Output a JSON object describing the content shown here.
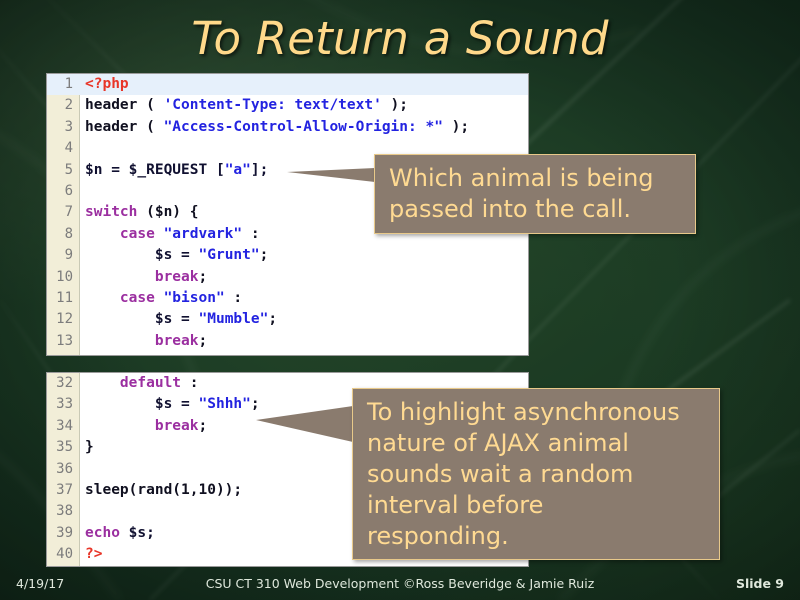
{
  "slide": {
    "title": "To Return a Sound",
    "colors": {
      "background_green": "#163220",
      "title_gold": "#ffd98a",
      "callout_fill": "#8a7b6e",
      "callout_border": "#e8c98a",
      "callout_text": "#ffda92",
      "code_background": "#ffffff",
      "gutter": "#f2eed8",
      "highlight_row": "#e6f0fb",
      "token_tag_red": "#e83528",
      "token_keyword_purple": "#9b2fa0",
      "token_string_blue": "#2323e0"
    }
  },
  "code_top": {
    "lines": [
      {
        "n": "1",
        "highlight": true,
        "tokens": [
          {
            "t": "<?php",
            "c": "tag"
          }
        ]
      },
      {
        "n": "2",
        "highlight": false,
        "tokens": [
          {
            "t": "header ( ",
            "c": "plain"
          },
          {
            "t": "'Content-Type: text/text'",
            "c": "str"
          },
          {
            "t": " );",
            "c": "plain"
          }
        ]
      },
      {
        "n": "3",
        "highlight": false,
        "tokens": [
          {
            "t": "header ( ",
            "c": "plain"
          },
          {
            "t": "\"Access-Control-Allow-Origin: *\"",
            "c": "str"
          },
          {
            "t": " );",
            "c": "plain"
          }
        ]
      },
      {
        "n": "4",
        "highlight": false,
        "tokens": [
          {
            "t": "",
            "c": "plain"
          }
        ]
      },
      {
        "n": "5",
        "highlight": false,
        "tokens": [
          {
            "t": "$n = $_REQUEST [",
            "c": "var"
          },
          {
            "t": "\"a\"",
            "c": "str"
          },
          {
            "t": "];",
            "c": "var"
          }
        ]
      },
      {
        "n": "6",
        "highlight": false,
        "tokens": [
          {
            "t": "",
            "c": "plain"
          }
        ]
      },
      {
        "n": "7",
        "highlight": false,
        "tokens": [
          {
            "t": "switch",
            "c": "kw"
          },
          {
            "t": " ($n) {",
            "c": "plain"
          }
        ]
      },
      {
        "n": "8",
        "highlight": false,
        "tokens": [
          {
            "t": "    ",
            "c": "plain"
          },
          {
            "t": "case",
            "c": "kw"
          },
          {
            "t": " ",
            "c": "plain"
          },
          {
            "t": "\"ardvark\"",
            "c": "str"
          },
          {
            "t": " :",
            "c": "plain"
          }
        ]
      },
      {
        "n": "9",
        "highlight": false,
        "tokens": [
          {
            "t": "        $s = ",
            "c": "var"
          },
          {
            "t": "\"Grunt\"",
            "c": "str"
          },
          {
            "t": ";",
            "c": "plain"
          }
        ]
      },
      {
        "n": "10",
        "highlight": false,
        "tokens": [
          {
            "t": "        ",
            "c": "plain"
          },
          {
            "t": "break",
            "c": "kw"
          },
          {
            "t": ";",
            "c": "plain"
          }
        ]
      },
      {
        "n": "11",
        "highlight": false,
        "tokens": [
          {
            "t": "    ",
            "c": "plain"
          },
          {
            "t": "case",
            "c": "kw"
          },
          {
            "t": " ",
            "c": "plain"
          },
          {
            "t": "\"bison\"",
            "c": "str"
          },
          {
            "t": " :",
            "c": "plain"
          }
        ]
      },
      {
        "n": "12",
        "highlight": false,
        "tokens": [
          {
            "t": "        $s = ",
            "c": "var"
          },
          {
            "t": "\"Mumble\"",
            "c": "str"
          },
          {
            "t": ";",
            "c": "plain"
          }
        ]
      },
      {
        "n": "13",
        "highlight": false,
        "tokens": [
          {
            "t": "        ",
            "c": "plain"
          },
          {
            "t": "break",
            "c": "kw"
          },
          {
            "t": ";",
            "c": "plain"
          }
        ]
      }
    ]
  },
  "code_bottom": {
    "lines": [
      {
        "n": "32",
        "highlight": false,
        "tokens": [
          {
            "t": "    ",
            "c": "plain"
          },
          {
            "t": "default",
            "c": "kw"
          },
          {
            "t": " :",
            "c": "plain"
          }
        ]
      },
      {
        "n": "33",
        "highlight": false,
        "tokens": [
          {
            "t": "        $s = ",
            "c": "var"
          },
          {
            "t": "\"Shhh\"",
            "c": "str"
          },
          {
            "t": ";",
            "c": "plain"
          }
        ]
      },
      {
        "n": "34",
        "highlight": false,
        "tokens": [
          {
            "t": "        ",
            "c": "plain"
          },
          {
            "t": "break",
            "c": "kw"
          },
          {
            "t": ";",
            "c": "plain"
          }
        ]
      },
      {
        "n": "35",
        "highlight": false,
        "tokens": [
          {
            "t": "}",
            "c": "plain"
          }
        ]
      },
      {
        "n": "36",
        "highlight": false,
        "tokens": [
          {
            "t": "",
            "c": "plain"
          }
        ]
      },
      {
        "n": "37",
        "highlight": false,
        "tokens": [
          {
            "t": "sleep(rand(1,10));",
            "c": "plain"
          }
        ]
      },
      {
        "n": "38",
        "highlight": false,
        "tokens": [
          {
            "t": "",
            "c": "plain"
          }
        ]
      },
      {
        "n": "39",
        "highlight": false,
        "tokens": [
          {
            "t": "echo",
            "c": "kw"
          },
          {
            "t": " $s;",
            "c": "var"
          }
        ]
      },
      {
        "n": "40",
        "highlight": false,
        "tokens": [
          {
            "t": "?>",
            "c": "tag"
          }
        ]
      }
    ]
  },
  "callouts": [
    {
      "id": "which-animal",
      "lines": [
        "Which animal is being",
        "passed into the call."
      ]
    },
    {
      "id": "async-note",
      "lines": [
        "To highlight asynchronous",
        "nature of AJAX animal",
        "sounds wait a random",
        "interval before",
        "responding."
      ]
    }
  ],
  "footer": {
    "date": "4/19/17",
    "center": "CSU CT 310 Web Development ©Ross Beveridge & Jamie Ruiz",
    "slide_number": "Slide 9"
  }
}
